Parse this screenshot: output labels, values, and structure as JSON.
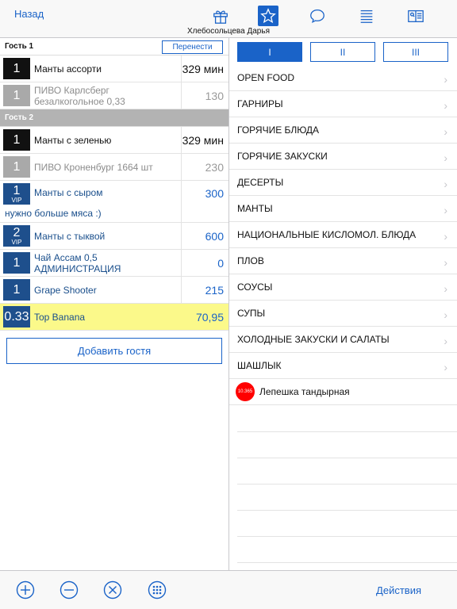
{
  "header": {
    "back_label": "Назад",
    "waiter_name": "Хлебосольцева Дарья",
    "tabs": [
      {
        "icon": "gift-icon",
        "active": false
      },
      {
        "icon": "star-icon",
        "active": true
      },
      {
        "icon": "chat-bubble-icon",
        "active": false
      },
      {
        "icon": "list-icon",
        "active": false
      },
      {
        "icon": "book-icon",
        "active": false
      }
    ]
  },
  "order": {
    "guest1": {
      "label": "Гость 1",
      "move_label": "Перенести",
      "items": [
        {
          "qty": "1",
          "name": "Манты ассорти",
          "price": "329 мин"
        },
        {
          "qty": "1",
          "name": "ПИВО Карлсберг безалкогольное 0,33",
          "price": "130"
        }
      ]
    },
    "guest2": {
      "label": "Гость 2",
      "items": [
        {
          "qty": "1",
          "name": "Манты с зеленью",
          "price": "329 мин"
        },
        {
          "qty": "1",
          "name": "ПИВО Кроненбург 1664 шт",
          "price": "230"
        },
        {
          "qty": "1",
          "vip": "VIP",
          "name": "Манты с сыром",
          "note": "нужно больше мяса :)",
          "price": "300"
        },
        {
          "qty": "2",
          "vip": "VIP",
          "name": "Манты с тыквой",
          "price": "600"
        },
        {
          "qty": "1",
          "name": "Чай Ассам 0,5 АДМИНИСТРАЦИЯ",
          "price": "0"
        },
        {
          "qty": "1",
          "name": "Grape Shooter",
          "price": "215"
        },
        {
          "qty": "0.33",
          "name": "Top Banana",
          "price": "70,95"
        }
      ]
    },
    "add_guest_label": "Добавить гостя"
  },
  "menu": {
    "segments": [
      "I",
      "II",
      "III"
    ],
    "active_segment": 0,
    "categories": [
      "OPEN FOOD",
      "ГАРНИРЫ",
      "ГОРЯЧИЕ БЛЮДА",
      "ГОРЯЧИЕ ЗАКУСКИ",
      "ДЕСЕРТЫ",
      "МАНТЫ",
      "НАЦИОНАЛЬНЫЕ КИСЛОМОЛ. БЛЮДА",
      "ПЛОВ",
      "СОУСЫ",
      "СУПЫ",
      "ХОЛОДНЫЕ ЗАКУСКИ И САЛАТЫ",
      "ШАШЛЫК"
    ],
    "dish": {
      "badge": "10.365",
      "name": "Лепешка тандырная"
    }
  },
  "footer": {
    "buttons": [
      "plus-circle-icon",
      "minus-circle-icon",
      "x-circle-icon",
      "keypad-icon"
    ],
    "actions_label": "Действия"
  },
  "colors": {
    "accent": "#1a63c8",
    "highlight": "#fbf98a",
    "badge_red": "#ff0000"
  }
}
